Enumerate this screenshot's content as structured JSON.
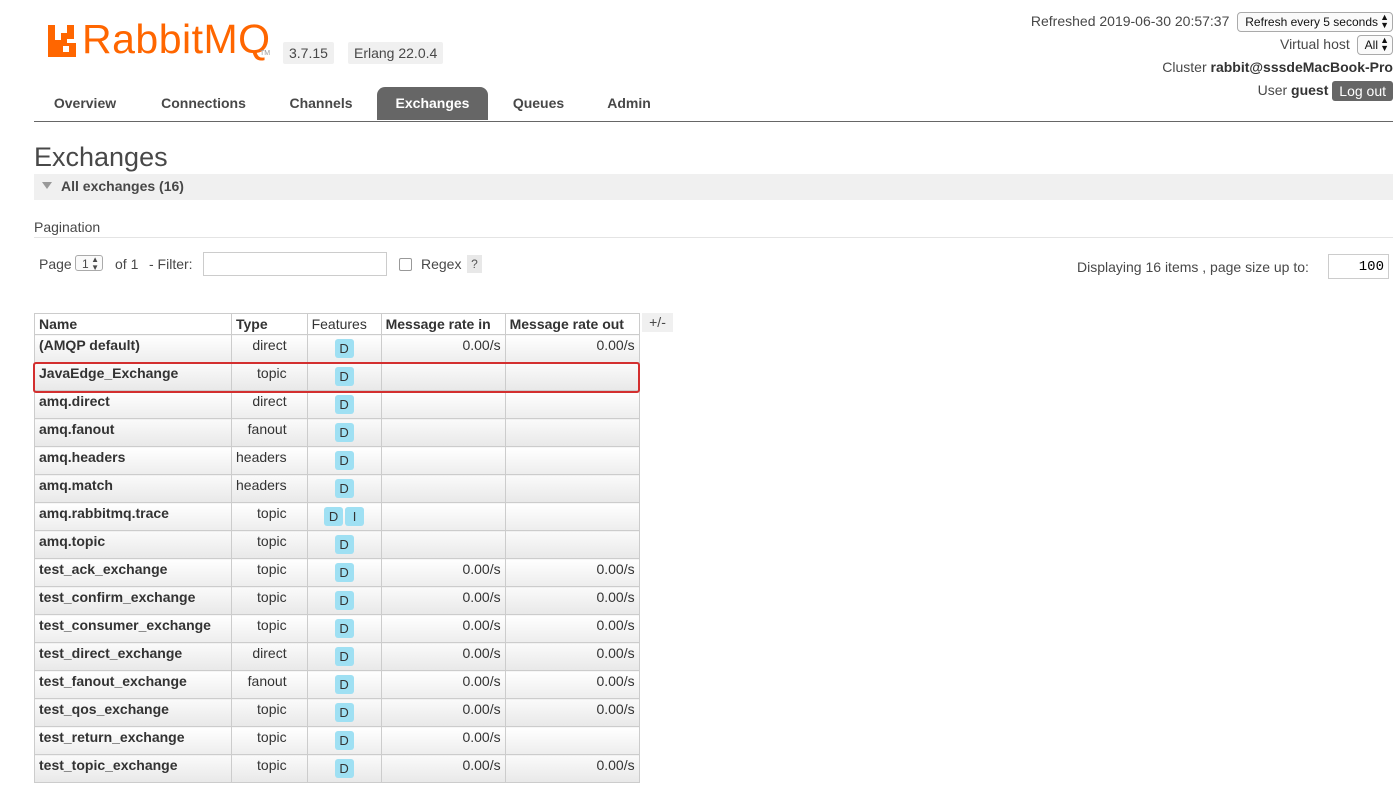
{
  "header": {
    "logo_text": "RabbitMQ",
    "logo_tm": "TM",
    "version": "3.7.15",
    "erlang": "Erlang 22.0.4",
    "brand_color": "#ff6600"
  },
  "status": {
    "refreshed": "Refreshed 2019-06-30 20:57:37",
    "refresh_select": "Refresh every 5 seconds",
    "vhost_label": "Virtual host",
    "vhost_select": "All",
    "cluster_label": "Cluster",
    "cluster_name": "rabbit@sssdeMacBook-Pro",
    "user_label": "User",
    "user_name": "guest",
    "logout": "Log out"
  },
  "tabs": [
    {
      "label": "Overview",
      "active": false
    },
    {
      "label": "Connections",
      "active": false
    },
    {
      "label": "Channels",
      "active": false
    },
    {
      "label": "Exchanges",
      "active": true
    },
    {
      "label": "Queues",
      "active": false
    },
    {
      "label": "Admin",
      "active": false
    }
  ],
  "page": {
    "title": "Exchanges",
    "section": "All exchanges (16)"
  },
  "pagination": {
    "label": "Pagination",
    "page_label": "Page",
    "page_value": "1",
    "of_label": "of 1",
    "filter_label": "- Filter:",
    "filter_value": "",
    "regex_label": "Regex",
    "regex_checked": false,
    "help": "?",
    "displaying": "Displaying 16 items , page size up to:",
    "page_size": "100"
  },
  "table": {
    "columns": [
      "Name",
      "Type",
      "Features",
      "Message rate in",
      "Message rate out"
    ],
    "toggle": "+/-",
    "rows": [
      {
        "name": "(AMQP default)",
        "type": "direct",
        "features": [
          "D"
        ],
        "rate_in": "0.00/s",
        "rate_out": "0.00/s"
      },
      {
        "name": "JavaEdge_Exchange",
        "type": "topic",
        "features": [
          "D"
        ],
        "rate_in": "",
        "rate_out": "",
        "highlighted": true
      },
      {
        "name": "amq.direct",
        "type": "direct",
        "features": [
          "D"
        ],
        "rate_in": "",
        "rate_out": ""
      },
      {
        "name": "amq.fanout",
        "type": "fanout",
        "features": [
          "D"
        ],
        "rate_in": "",
        "rate_out": ""
      },
      {
        "name": "amq.headers",
        "type": "headers",
        "features": [
          "D"
        ],
        "rate_in": "",
        "rate_out": ""
      },
      {
        "name": "amq.match",
        "type": "headers",
        "features": [
          "D"
        ],
        "rate_in": "",
        "rate_out": ""
      },
      {
        "name": "amq.rabbitmq.trace",
        "type": "topic",
        "features": [
          "D",
          "I"
        ],
        "rate_in": "",
        "rate_out": ""
      },
      {
        "name": "amq.topic",
        "type": "topic",
        "features": [
          "D"
        ],
        "rate_in": "",
        "rate_out": ""
      },
      {
        "name": "test_ack_exchange",
        "type": "topic",
        "features": [
          "D"
        ],
        "rate_in": "0.00/s",
        "rate_out": "0.00/s"
      },
      {
        "name": "test_confirm_exchange",
        "type": "topic",
        "features": [
          "D"
        ],
        "rate_in": "0.00/s",
        "rate_out": "0.00/s"
      },
      {
        "name": "test_consumer_exchange",
        "type": "topic",
        "features": [
          "D"
        ],
        "rate_in": "0.00/s",
        "rate_out": "0.00/s"
      },
      {
        "name": "test_direct_exchange",
        "type": "direct",
        "features": [
          "D"
        ],
        "rate_in": "0.00/s",
        "rate_out": "0.00/s"
      },
      {
        "name": "test_fanout_exchange",
        "type": "fanout",
        "features": [
          "D"
        ],
        "rate_in": "0.00/s",
        "rate_out": "0.00/s"
      },
      {
        "name": "test_qos_exchange",
        "type": "topic",
        "features": [
          "D"
        ],
        "rate_in": "0.00/s",
        "rate_out": "0.00/s"
      },
      {
        "name": "test_return_exchange",
        "type": "topic",
        "features": [
          "D"
        ],
        "rate_in": "0.00/s",
        "rate_out": ""
      },
      {
        "name": "test_topic_exchange",
        "type": "topic",
        "features": [
          "D"
        ],
        "rate_in": "0.00/s",
        "rate_out": "0.00/s"
      }
    ]
  },
  "colors": {
    "tab_active": "#666666",
    "badge": "#9fe0f3",
    "highlight_box": "#d32f2f"
  }
}
